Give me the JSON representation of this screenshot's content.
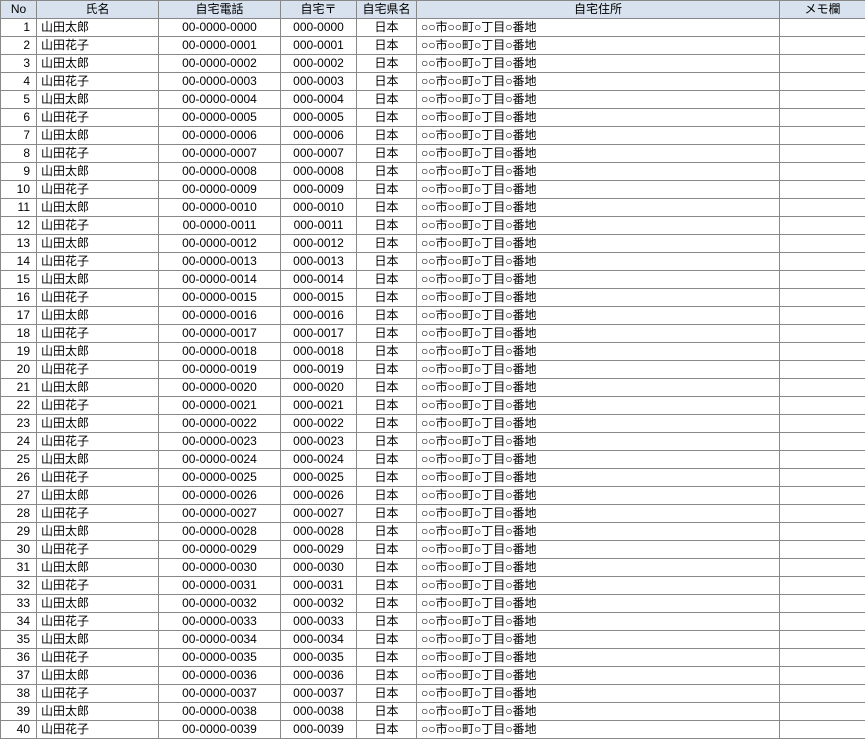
{
  "headers": {
    "no": "No",
    "name": "氏名",
    "phone": "自宅電話",
    "zip": "自宅〒",
    "pref": "自宅県名",
    "addr": "自宅住所",
    "memo": "メモ欄"
  },
  "rows": [
    {
      "no": "1",
      "name": "山田太郎",
      "phone": "00-0000-0000",
      "zip": "000-0000",
      "pref": "日本",
      "addr": "○○市○○町○丁目○番地",
      "memo": ""
    },
    {
      "no": "2",
      "name": "山田花子",
      "phone": "00-0000-0001",
      "zip": "000-0001",
      "pref": "日本",
      "addr": "○○市○○町○丁目○番地",
      "memo": ""
    },
    {
      "no": "3",
      "name": "山田太郎",
      "phone": "00-0000-0002",
      "zip": "000-0002",
      "pref": "日本",
      "addr": "○○市○○町○丁目○番地",
      "memo": ""
    },
    {
      "no": "4",
      "name": "山田花子",
      "phone": "00-0000-0003",
      "zip": "000-0003",
      "pref": "日本",
      "addr": "○○市○○町○丁目○番地",
      "memo": ""
    },
    {
      "no": "5",
      "name": "山田太郎",
      "phone": "00-0000-0004",
      "zip": "000-0004",
      "pref": "日本",
      "addr": "○○市○○町○丁目○番地",
      "memo": ""
    },
    {
      "no": "6",
      "name": "山田花子",
      "phone": "00-0000-0005",
      "zip": "000-0005",
      "pref": "日本",
      "addr": "○○市○○町○丁目○番地",
      "memo": ""
    },
    {
      "no": "7",
      "name": "山田太郎",
      "phone": "00-0000-0006",
      "zip": "000-0006",
      "pref": "日本",
      "addr": "○○市○○町○丁目○番地",
      "memo": ""
    },
    {
      "no": "8",
      "name": "山田花子",
      "phone": "00-0000-0007",
      "zip": "000-0007",
      "pref": "日本",
      "addr": "○○市○○町○丁目○番地",
      "memo": ""
    },
    {
      "no": "9",
      "name": "山田太郎",
      "phone": "00-0000-0008",
      "zip": "000-0008",
      "pref": "日本",
      "addr": "○○市○○町○丁目○番地",
      "memo": ""
    },
    {
      "no": "10",
      "name": "山田花子",
      "phone": "00-0000-0009",
      "zip": "000-0009",
      "pref": "日本",
      "addr": "○○市○○町○丁目○番地",
      "memo": ""
    },
    {
      "no": "11",
      "name": "山田太郎",
      "phone": "00-0000-0010",
      "zip": "000-0010",
      "pref": "日本",
      "addr": "○○市○○町○丁目○番地",
      "memo": ""
    },
    {
      "no": "12",
      "name": "山田花子",
      "phone": "00-0000-0011",
      "zip": "000-0011",
      "pref": "日本",
      "addr": "○○市○○町○丁目○番地",
      "memo": ""
    },
    {
      "no": "13",
      "name": "山田太郎",
      "phone": "00-0000-0012",
      "zip": "000-0012",
      "pref": "日本",
      "addr": "○○市○○町○丁目○番地",
      "memo": ""
    },
    {
      "no": "14",
      "name": "山田花子",
      "phone": "00-0000-0013",
      "zip": "000-0013",
      "pref": "日本",
      "addr": "○○市○○町○丁目○番地",
      "memo": ""
    },
    {
      "no": "15",
      "name": "山田太郎",
      "phone": "00-0000-0014",
      "zip": "000-0014",
      "pref": "日本",
      "addr": "○○市○○町○丁目○番地",
      "memo": ""
    },
    {
      "no": "16",
      "name": "山田花子",
      "phone": "00-0000-0015",
      "zip": "000-0015",
      "pref": "日本",
      "addr": "○○市○○町○丁目○番地",
      "memo": ""
    },
    {
      "no": "17",
      "name": "山田太郎",
      "phone": "00-0000-0016",
      "zip": "000-0016",
      "pref": "日本",
      "addr": "○○市○○町○丁目○番地",
      "memo": ""
    },
    {
      "no": "18",
      "name": "山田花子",
      "phone": "00-0000-0017",
      "zip": "000-0017",
      "pref": "日本",
      "addr": "○○市○○町○丁目○番地",
      "memo": ""
    },
    {
      "no": "19",
      "name": "山田太郎",
      "phone": "00-0000-0018",
      "zip": "000-0018",
      "pref": "日本",
      "addr": "○○市○○町○丁目○番地",
      "memo": ""
    },
    {
      "no": "20",
      "name": "山田花子",
      "phone": "00-0000-0019",
      "zip": "000-0019",
      "pref": "日本",
      "addr": "○○市○○町○丁目○番地",
      "memo": ""
    },
    {
      "no": "21",
      "name": "山田太郎",
      "phone": "00-0000-0020",
      "zip": "000-0020",
      "pref": "日本",
      "addr": "○○市○○町○丁目○番地",
      "memo": ""
    },
    {
      "no": "22",
      "name": "山田花子",
      "phone": "00-0000-0021",
      "zip": "000-0021",
      "pref": "日本",
      "addr": "○○市○○町○丁目○番地",
      "memo": ""
    },
    {
      "no": "23",
      "name": "山田太郎",
      "phone": "00-0000-0022",
      "zip": "000-0022",
      "pref": "日本",
      "addr": "○○市○○町○丁目○番地",
      "memo": ""
    },
    {
      "no": "24",
      "name": "山田花子",
      "phone": "00-0000-0023",
      "zip": "000-0023",
      "pref": "日本",
      "addr": "○○市○○町○丁目○番地",
      "memo": ""
    },
    {
      "no": "25",
      "name": "山田太郎",
      "phone": "00-0000-0024",
      "zip": "000-0024",
      "pref": "日本",
      "addr": "○○市○○町○丁目○番地",
      "memo": ""
    },
    {
      "no": "26",
      "name": "山田花子",
      "phone": "00-0000-0025",
      "zip": "000-0025",
      "pref": "日本",
      "addr": "○○市○○町○丁目○番地",
      "memo": ""
    },
    {
      "no": "27",
      "name": "山田太郎",
      "phone": "00-0000-0026",
      "zip": "000-0026",
      "pref": "日本",
      "addr": "○○市○○町○丁目○番地",
      "memo": ""
    },
    {
      "no": "28",
      "name": "山田花子",
      "phone": "00-0000-0027",
      "zip": "000-0027",
      "pref": "日本",
      "addr": "○○市○○町○丁目○番地",
      "memo": ""
    },
    {
      "no": "29",
      "name": "山田太郎",
      "phone": "00-0000-0028",
      "zip": "000-0028",
      "pref": "日本",
      "addr": "○○市○○町○丁目○番地",
      "memo": ""
    },
    {
      "no": "30",
      "name": "山田花子",
      "phone": "00-0000-0029",
      "zip": "000-0029",
      "pref": "日本",
      "addr": "○○市○○町○丁目○番地",
      "memo": ""
    },
    {
      "no": "31",
      "name": "山田太郎",
      "phone": "00-0000-0030",
      "zip": "000-0030",
      "pref": "日本",
      "addr": "○○市○○町○丁目○番地",
      "memo": ""
    },
    {
      "no": "32",
      "name": "山田花子",
      "phone": "00-0000-0031",
      "zip": "000-0031",
      "pref": "日本",
      "addr": "○○市○○町○丁目○番地",
      "memo": ""
    },
    {
      "no": "33",
      "name": "山田太郎",
      "phone": "00-0000-0032",
      "zip": "000-0032",
      "pref": "日本",
      "addr": "○○市○○町○丁目○番地",
      "memo": ""
    },
    {
      "no": "34",
      "name": "山田花子",
      "phone": "00-0000-0033",
      "zip": "000-0033",
      "pref": "日本",
      "addr": "○○市○○町○丁目○番地",
      "memo": ""
    },
    {
      "no": "35",
      "name": "山田太郎",
      "phone": "00-0000-0034",
      "zip": "000-0034",
      "pref": "日本",
      "addr": "○○市○○町○丁目○番地",
      "memo": ""
    },
    {
      "no": "36",
      "name": "山田花子",
      "phone": "00-0000-0035",
      "zip": "000-0035",
      "pref": "日本",
      "addr": "○○市○○町○丁目○番地",
      "memo": ""
    },
    {
      "no": "37",
      "name": "山田太郎",
      "phone": "00-0000-0036",
      "zip": "000-0036",
      "pref": "日本",
      "addr": "○○市○○町○丁目○番地",
      "memo": ""
    },
    {
      "no": "38",
      "name": "山田花子",
      "phone": "00-0000-0037",
      "zip": "000-0037",
      "pref": "日本",
      "addr": "○○市○○町○丁目○番地",
      "memo": ""
    },
    {
      "no": "39",
      "name": "山田太郎",
      "phone": "00-0000-0038",
      "zip": "000-0038",
      "pref": "日本",
      "addr": "○○市○○町○丁目○番地",
      "memo": ""
    },
    {
      "no": "40",
      "name": "山田花子",
      "phone": "00-0000-0039",
      "zip": "000-0039",
      "pref": "日本",
      "addr": "○○市○○町○丁目○番地",
      "memo": ""
    }
  ]
}
